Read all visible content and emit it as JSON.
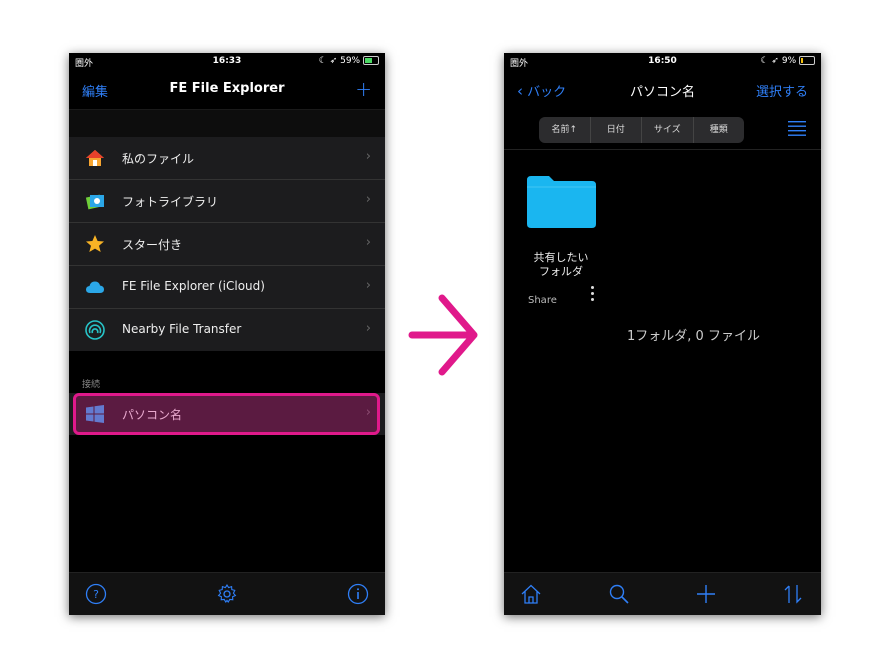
{
  "left": {
    "status": {
      "carrier": "圏外",
      "time": "16:33",
      "battery": "59%"
    },
    "nav": {
      "left": "編集",
      "title": "FE File Explorer",
      "right": "+"
    },
    "items": [
      {
        "label": "私のファイル",
        "icon": "home-icon"
      },
      {
        "label": "フォトライブラリ",
        "icon": "photos-icon"
      },
      {
        "label": "スター付き",
        "icon": "star-icon"
      },
      {
        "label": "FE File Explorer (iCloud)",
        "icon": "cloud-icon"
      },
      {
        "label": "Nearby File Transfer",
        "icon": "nearby-transfer-icon"
      }
    ],
    "section_header": "接続",
    "connection": {
      "label": "パソコン名",
      "icon": "windows-icon"
    },
    "toolbar": [
      "help-icon",
      "settings-icon",
      "info-icon"
    ]
  },
  "right": {
    "status": {
      "carrier": "圏外",
      "time": "16:50",
      "battery": "9%"
    },
    "nav": {
      "back": "バック",
      "title": "パソコン名",
      "right": "選択する"
    },
    "sort": [
      "名前↑",
      "日付",
      "サイズ",
      "種類"
    ],
    "folder": {
      "name_line1": "共有したい",
      "name_line2": "フォルダ",
      "sub": "Share"
    },
    "summary": "1フォルダ, 0 ファイル",
    "toolbar": [
      "home-icon",
      "search-icon",
      "add-icon",
      "sort-icon"
    ]
  },
  "colors": {
    "accent": "#2f7ff7",
    "highlight": "#e0198b",
    "folder": "#1ab6f0"
  }
}
